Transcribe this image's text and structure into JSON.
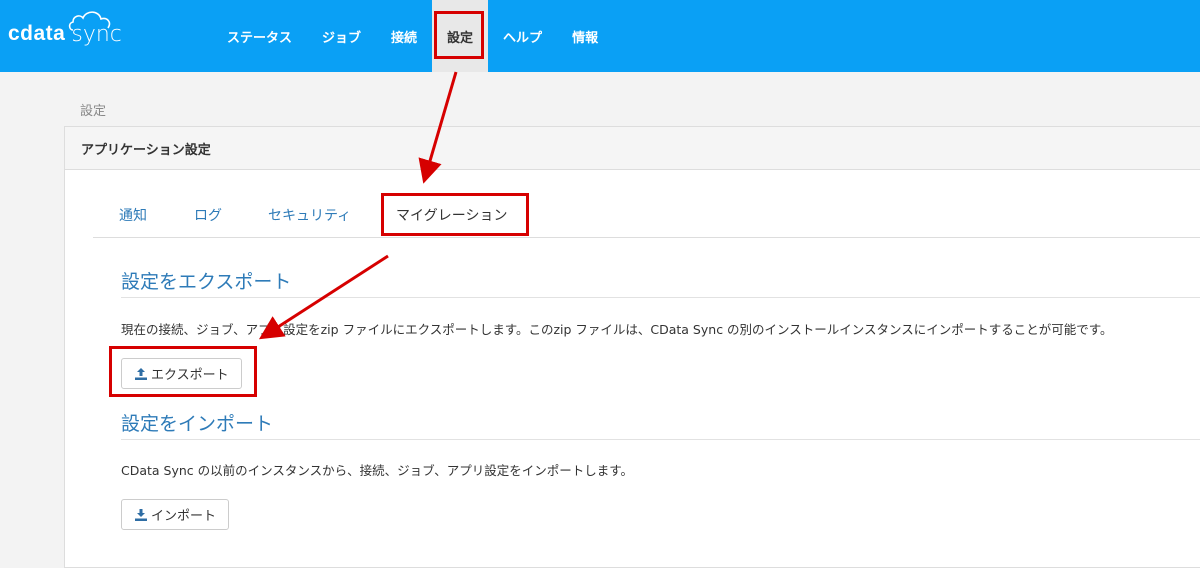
{
  "logo": {
    "brand": "cdata",
    "product": "sync"
  },
  "nav": {
    "items": [
      {
        "label": "ステータス"
      },
      {
        "label": "ジョブ"
      },
      {
        "label": "接続"
      },
      {
        "label": "設定"
      },
      {
        "label": "ヘルプ"
      },
      {
        "label": "情報"
      }
    ],
    "active_index": 3
  },
  "breadcrumb": "設定",
  "panel": {
    "title": "アプリケーション設定",
    "tabs": [
      {
        "label": "通知"
      },
      {
        "label": "ログ"
      },
      {
        "label": "セキュリティ"
      },
      {
        "label": "マイグレーション"
      }
    ],
    "active_tab": 3
  },
  "export": {
    "title": "設定をエクスポート",
    "description": "現在の接続、ジョブ、アプリ設定をzip ファイルにエクスポートします。このzip ファイルは、CData Sync の別のインストールインスタンスにインポートすることが可能です。",
    "button_label": "エクスポート",
    "button_icon": "upload-icon"
  },
  "import": {
    "title": "設定をインポート",
    "description": "CData Sync の以前のインスタンスから、接続、ジョブ、アプリ設定をインポートします。",
    "button_label": "インポート",
    "button_icon": "download-icon"
  },
  "colors": {
    "topbar": "#0aa0f5",
    "link": "#2e7bb8",
    "highlight": "#d60000"
  }
}
